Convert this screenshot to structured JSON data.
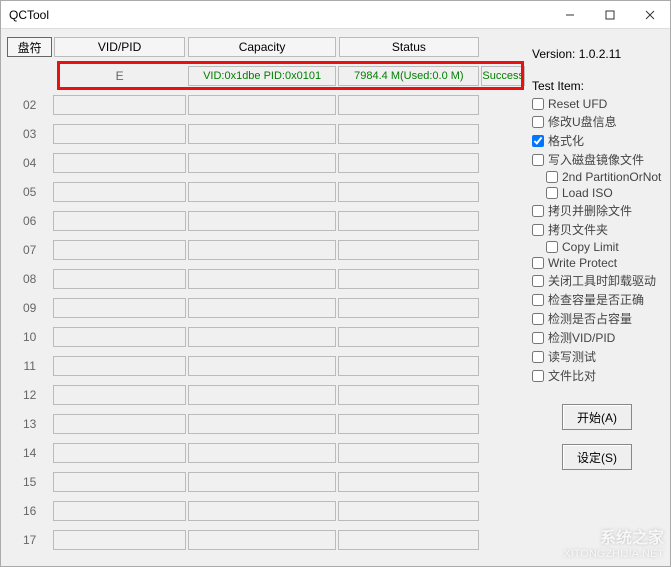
{
  "window": {
    "title": "QCTool"
  },
  "headers": {
    "drive": "盘符",
    "vidpid": "VID/PID",
    "capacity": "Capacity",
    "status": "Status"
  },
  "rows": [
    {
      "label": "E",
      "vidpid": "VID:0x1dbe PID:0x0101",
      "capacity": "7984.4 M(Used:0.0 M)",
      "status": "Success",
      "hl": true
    },
    {
      "label": "02"
    },
    {
      "label": "03"
    },
    {
      "label": "04"
    },
    {
      "label": "05"
    },
    {
      "label": "06"
    },
    {
      "label": "07"
    },
    {
      "label": "08"
    },
    {
      "label": "09"
    },
    {
      "label": "10"
    },
    {
      "label": "11"
    },
    {
      "label": "12"
    },
    {
      "label": "13"
    },
    {
      "label": "14"
    },
    {
      "label": "15"
    },
    {
      "label": "16"
    },
    {
      "label": "17"
    }
  ],
  "right": {
    "version": "Version: 1.0.2.11",
    "testitem_title": "Test Item:",
    "checks": [
      {
        "label": "Reset UFD",
        "checked": false,
        "indent": false
      },
      {
        "label": "修改U盘信息",
        "checked": false,
        "indent": false
      },
      {
        "label": "格式化",
        "checked": true,
        "indent": false
      },
      {
        "label": "写入磁盘镜像文件",
        "checked": false,
        "indent": false
      },
      {
        "label": "2nd PartitionOrNot",
        "checked": false,
        "indent": true
      },
      {
        "label": "Load ISO",
        "checked": false,
        "indent": true
      },
      {
        "label": "拷贝并删除文件",
        "checked": false,
        "indent": false
      },
      {
        "label": "拷贝文件夹",
        "checked": false,
        "indent": false
      },
      {
        "label": "Copy Limit",
        "checked": false,
        "indent": true
      },
      {
        "label": "Write Protect",
        "checked": false,
        "indent": false
      },
      {
        "label": "关闭工具时卸载驱动",
        "checked": false,
        "indent": false
      },
      {
        "label": "检查容量是否正确",
        "checked": false,
        "indent": false
      },
      {
        "label": "检测是否占容量",
        "checked": false,
        "indent": false
      },
      {
        "label": "检测VID/PID",
        "checked": false,
        "indent": false
      },
      {
        "label": "读写测试",
        "checked": false,
        "indent": false
      },
      {
        "label": "文件比对",
        "checked": false,
        "indent": false
      }
    ],
    "btn_start": "开始(A)",
    "btn_settings": "设定(S)"
  },
  "watermark": {
    "logo": "系统之家",
    "url": "XITONGZHIJIA.NET"
  }
}
